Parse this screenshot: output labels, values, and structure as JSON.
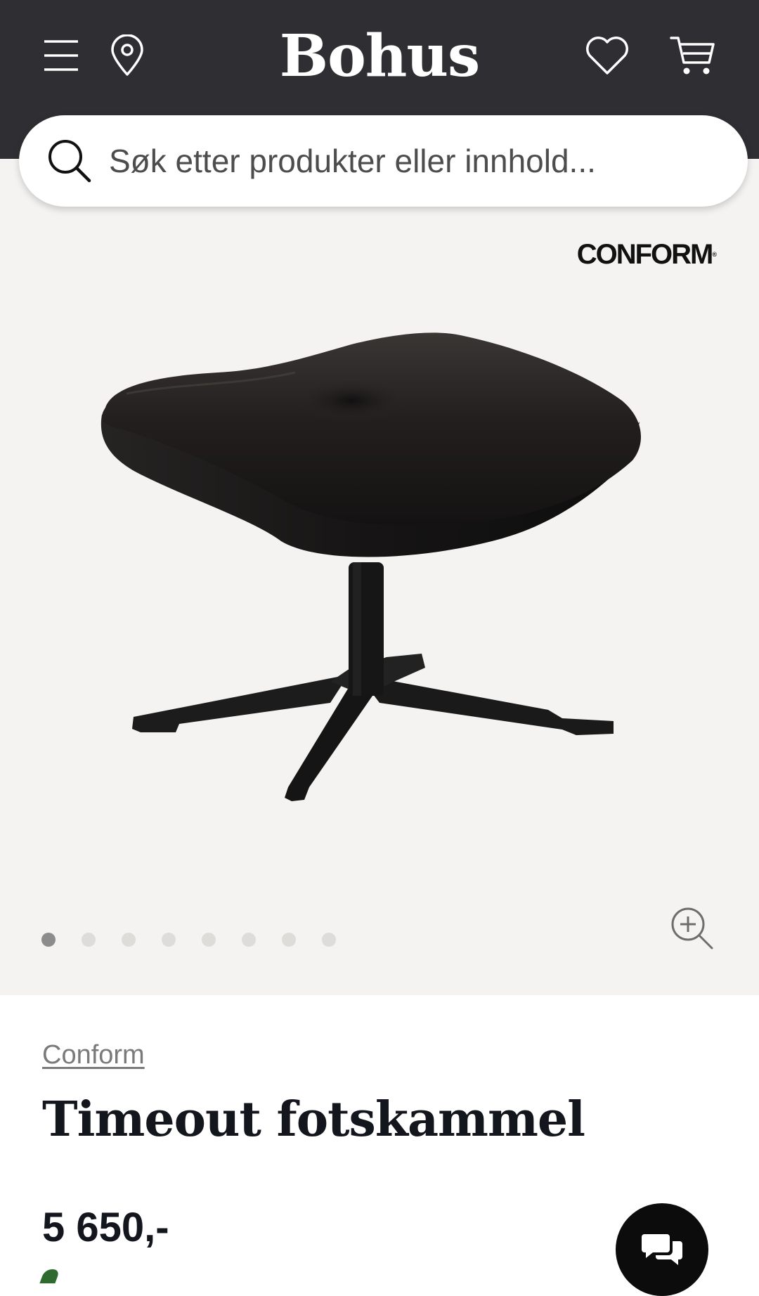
{
  "header": {
    "logo_text": "Bohus",
    "icons": [
      "menu-icon",
      "location-pin-icon",
      "heart-icon",
      "cart-icon"
    ],
    "background_color": "#2e2e33"
  },
  "search": {
    "placeholder": "Søk etter produkter eller innhold..."
  },
  "gallery": {
    "brand_logo_text": "CONFORM",
    "brand_logo_mark": "®",
    "image_alt": "Timeout fotskammel, svart skinn med firearmet fot",
    "dot_count": 8,
    "active_dot": 1,
    "background_color": "#f4f3f1"
  },
  "product": {
    "brand": "Conform",
    "title": "Timeout fotskammel",
    "price": "5 650,-"
  },
  "chat": {
    "icon": "chat-bubbles-icon"
  }
}
